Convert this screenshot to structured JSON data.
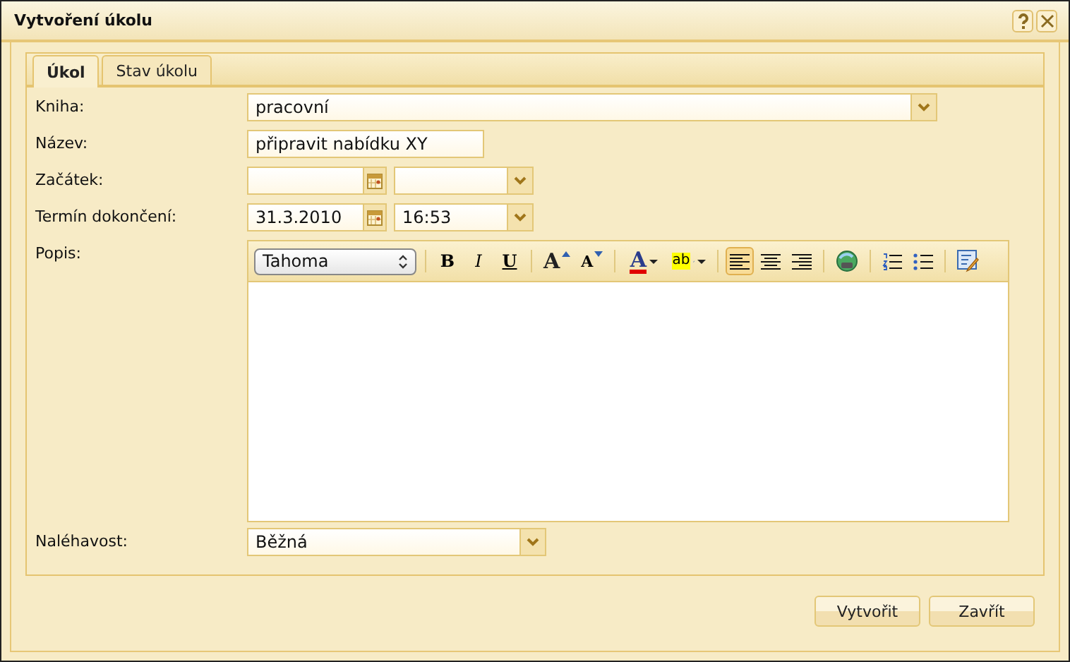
{
  "window": {
    "title": "Vytvoření úkolu"
  },
  "tabs": [
    {
      "label": "Úkol",
      "selected": true
    },
    {
      "label": "Stav úkolu",
      "selected": false
    }
  ],
  "form": [
    {
      "label": "Kniha:",
      "kind": "select",
      "value": "pracovní"
    },
    {
      "label": "Název:",
      "kind": "text",
      "value": "připravit nabídku XY"
    },
    {
      "label": "Začátek:",
      "kind": "datetime"
    },
    {
      "label": "Termín dokončení:",
      "kind": "datetime",
      "date": "31.3.2010",
      "time": "16:53"
    },
    {
      "label": "Popis:",
      "kind": "editor"
    },
    {
      "label": "Naléhavost:",
      "kind": "priority",
      "value": "Běžná"
    }
  ],
  "editor": {
    "font": "Tahoma",
    "groups": [
      [
        {
          "kind": "bold",
          "label": "B"
        },
        {
          "kind": "italic",
          "label": "I"
        },
        {
          "kind": "underline",
          "label": "U"
        }
      ],
      [
        {
          "kind": "grow",
          "label": "A"
        },
        {
          "kind": "shrink",
          "label": "A"
        }
      ],
      [
        {
          "kind": "color",
          "label": "A"
        },
        {
          "kind": "highlight",
          "label": "ab"
        }
      ],
      [
        {
          "kind": "align-left",
          "selected": true
        },
        {
          "kind": "align-center",
          "selected": false
        },
        {
          "kind": "align-right",
          "selected": false
        }
      ],
      [
        {
          "kind": "link"
        }
      ],
      [
        {
          "kind": "ordered-list"
        },
        {
          "kind": "bullet-list"
        }
      ],
      [
        {
          "kind": "source"
        }
      ]
    ]
  },
  "buttons": [
    "Vytvořit",
    "Zavřít"
  ]
}
